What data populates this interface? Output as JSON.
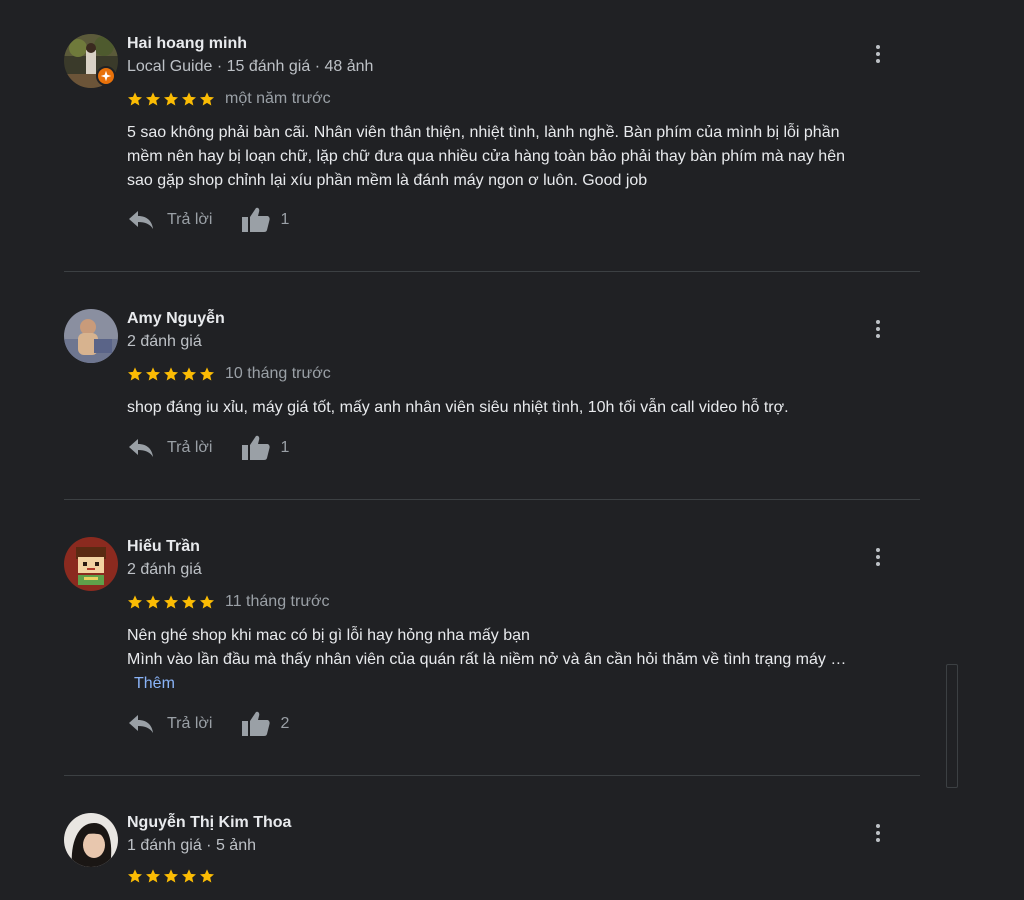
{
  "reviews": [
    {
      "name": "Hai hoang minh",
      "meta": "Local Guide · 15 đánh giá · 48 ảnh",
      "time": "một năm trước",
      "body": [
        "5 sao không phải bàn cãi. Nhân viên thân thiện, nhiệt tình, lành nghề. Bàn phím của mình bị lỗi phần",
        "mềm nên hay bị loạn chữ, lặp chữ đưa qua nhiều cửa hàng toàn bảo phải thay bàn phím mà nay hên",
        "sao gặp shop chỉnh lại xíu phần mềm là đánh máy ngon ơ luôn. Good job"
      ],
      "reply_label": "Trả lời",
      "likes": "1",
      "rating": 5
    },
    {
      "name": "Amy Nguyễn",
      "meta": "2 đánh giá",
      "time": "10 tháng trước",
      "body": [
        "shop đáng iu xỉu, máy giá tốt, mấy anh nhân viên siêu nhiệt tình, 10h tối vẫn call video hỗ trợ."
      ],
      "reply_label": "Trả lời",
      "likes": "1",
      "rating": 5
    },
    {
      "name": "Hiếu Trần",
      "meta": "2 đánh giá",
      "time": "11 tháng trước",
      "body": [
        "Nên ghé shop khi mac có bị gì lỗi hay hỏng nha mấy bạn",
        "Mình vào lần đầu mà thấy nhân viên của quán rất là niềm nở và ân cần hỏi thăm về tình trạng máy …"
      ],
      "more_label": "Thêm",
      "reply_label": "Trả lời",
      "likes": "2",
      "rating": 5
    },
    {
      "name": "Nguyễn Thị Kim Thoa",
      "meta": "1 đánh giá · 5 ảnh"
    }
  ],
  "colors": {
    "background": "#202124",
    "star": "#fbbc04",
    "link": "#8ab4f8",
    "local_guide_badge": "#e8710a"
  },
  "icons": {
    "reply": "reply-arrow-icon",
    "like": "thumbs-up-icon",
    "menu": "more-vert-icon",
    "star": "star-icon"
  }
}
